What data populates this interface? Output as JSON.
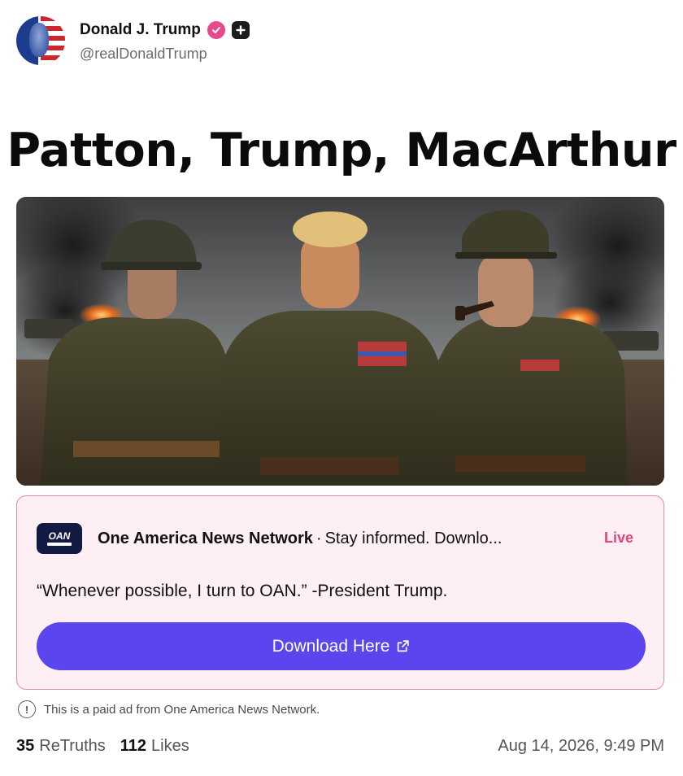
{
  "author": {
    "display_name": "Donald J. Trump",
    "handle": "@realDonaldTrump",
    "avatar_icon": "flag-portrait-avatar",
    "verified_icon": "verified-badge-icon",
    "verified_color": "#e8488e"
  },
  "post": {
    "title": "Patton, Trump, MacArthur",
    "media_description_icon": "ai-image-three-generals"
  },
  "ad": {
    "source": "One America News Network",
    "separator": "·",
    "tagline": "Stay informed. Downlo...",
    "live_label": "Live",
    "quote": "“Whenever possible, I turn to OAN.” -President Trump.",
    "cta_label": "Download Here",
    "logo_text": "OAN",
    "accent_color": "#5a45ef",
    "card_bg": "#fdeff3",
    "border_color": "#e58aa6"
  },
  "disclaimer": "This is a paid ad from One America News Network.",
  "stats": {
    "retruths_count": "35",
    "retruths_label": "ReTruths",
    "likes_count": "112",
    "likes_label": "Likes"
  },
  "timestamp": "Aug 14, 2026, 9:49 PM"
}
